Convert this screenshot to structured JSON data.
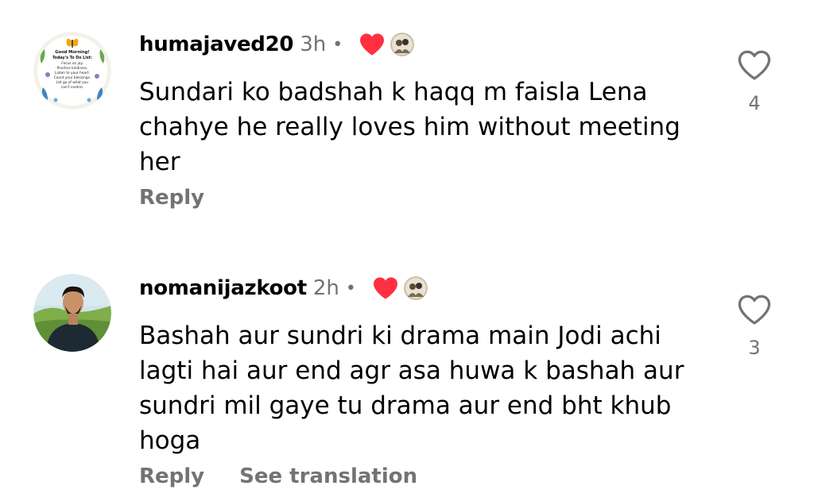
{
  "comments": [
    {
      "username": "humajaved20",
      "time": "3h",
      "separator": "•",
      "text": "Sundari ko badshah k haqq m faisla Lena chahye he really loves him without meeting her",
      "reply_label": "Reply",
      "like_count": "4",
      "avatar_text": {
        "line1": "Good Morning!",
        "line2": "Today's To Do List:",
        "line3": "Focus on joy.",
        "line4": "Practice kindness.",
        "line5": "Listen to your heart.",
        "line6": "Count your blessings.",
        "line7": "Let go of what you",
        "line8": "can't control."
      }
    },
    {
      "username": "nomanijazkoot",
      "time": "2h",
      "separator": "•",
      "text": "Bashah aur sundri ki drama main Jodi achi lagti hai aur end agr asa huwa k bashah aur sundri mil gaye tu drama aur end bht khub hoga",
      "reply_label": "Reply",
      "translate_label": "See translation",
      "like_count": "3"
    }
  ],
  "colors": {
    "secondary_text": "#737373",
    "creator_heart": "#ff3040",
    "primary_text": "#000000"
  },
  "icons": {
    "creator_liked": "heart-filled-icon",
    "like": "heart-outline-icon"
  }
}
